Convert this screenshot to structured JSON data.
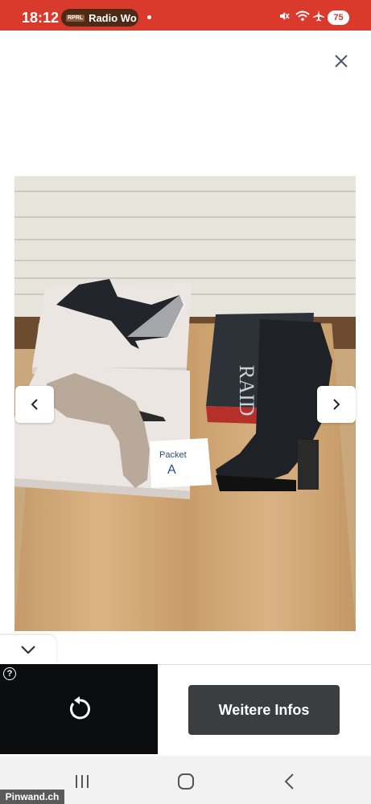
{
  "status_bar": {
    "time": "18:12",
    "radio_tag": "RPRL",
    "radio_label": "Radio Wo",
    "battery": "75"
  },
  "photo": {
    "box_brand": "RAID",
    "note_text_line1": "Packet",
    "note_text_line2": "A"
  },
  "ad": {
    "cta_label": "Weitere Infos",
    "help": "?"
  },
  "watermark": "Pinwand.ch"
}
